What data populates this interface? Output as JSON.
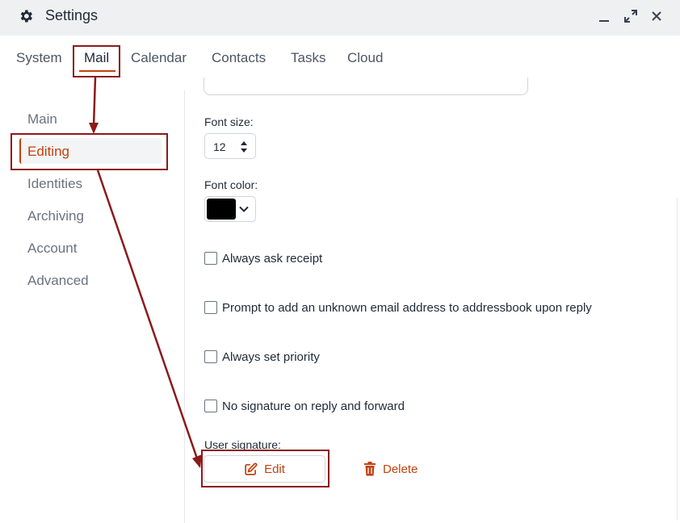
{
  "window": {
    "title": "Settings",
    "icons": [
      "gear-icon",
      "minimize-icon",
      "maximize-icon",
      "close-icon"
    ]
  },
  "tabs": [
    {
      "label": "System",
      "active": false
    },
    {
      "label": "Mail",
      "active": true
    },
    {
      "label": "Calendar",
      "active": false
    },
    {
      "label": "Contacts",
      "active": false
    },
    {
      "label": "Tasks",
      "active": false
    },
    {
      "label": "Cloud",
      "active": false
    }
  ],
  "sidebar": {
    "items": [
      {
        "label": "Main",
        "active": false
      },
      {
        "label": "Editing",
        "active": true
      },
      {
        "label": "Identities",
        "active": false
      },
      {
        "label": "Archiving",
        "active": false
      },
      {
        "label": "Account",
        "active": false
      },
      {
        "label": "Advanced",
        "active": false
      }
    ]
  },
  "editing": {
    "font_size_label": "Font size:",
    "font_size_value": "12",
    "font_color_label": "Font color:",
    "font_color_value": "#000000",
    "options": [
      {
        "label": "Always ask receipt",
        "checked": false
      },
      {
        "label": "Prompt to add an unknown email address to addressbook upon reply",
        "checked": false
      },
      {
        "label": "Always set priority",
        "checked": false
      },
      {
        "label": "No signature on reply and forward",
        "checked": false
      }
    ],
    "signature_label": "User signature:",
    "edit_label": "Edit",
    "delete_label": "Delete"
  },
  "colors": {
    "accent": "#c2410c",
    "annotation": "#8b1a1a",
    "titlebar_bg": "#eef0f2"
  }
}
